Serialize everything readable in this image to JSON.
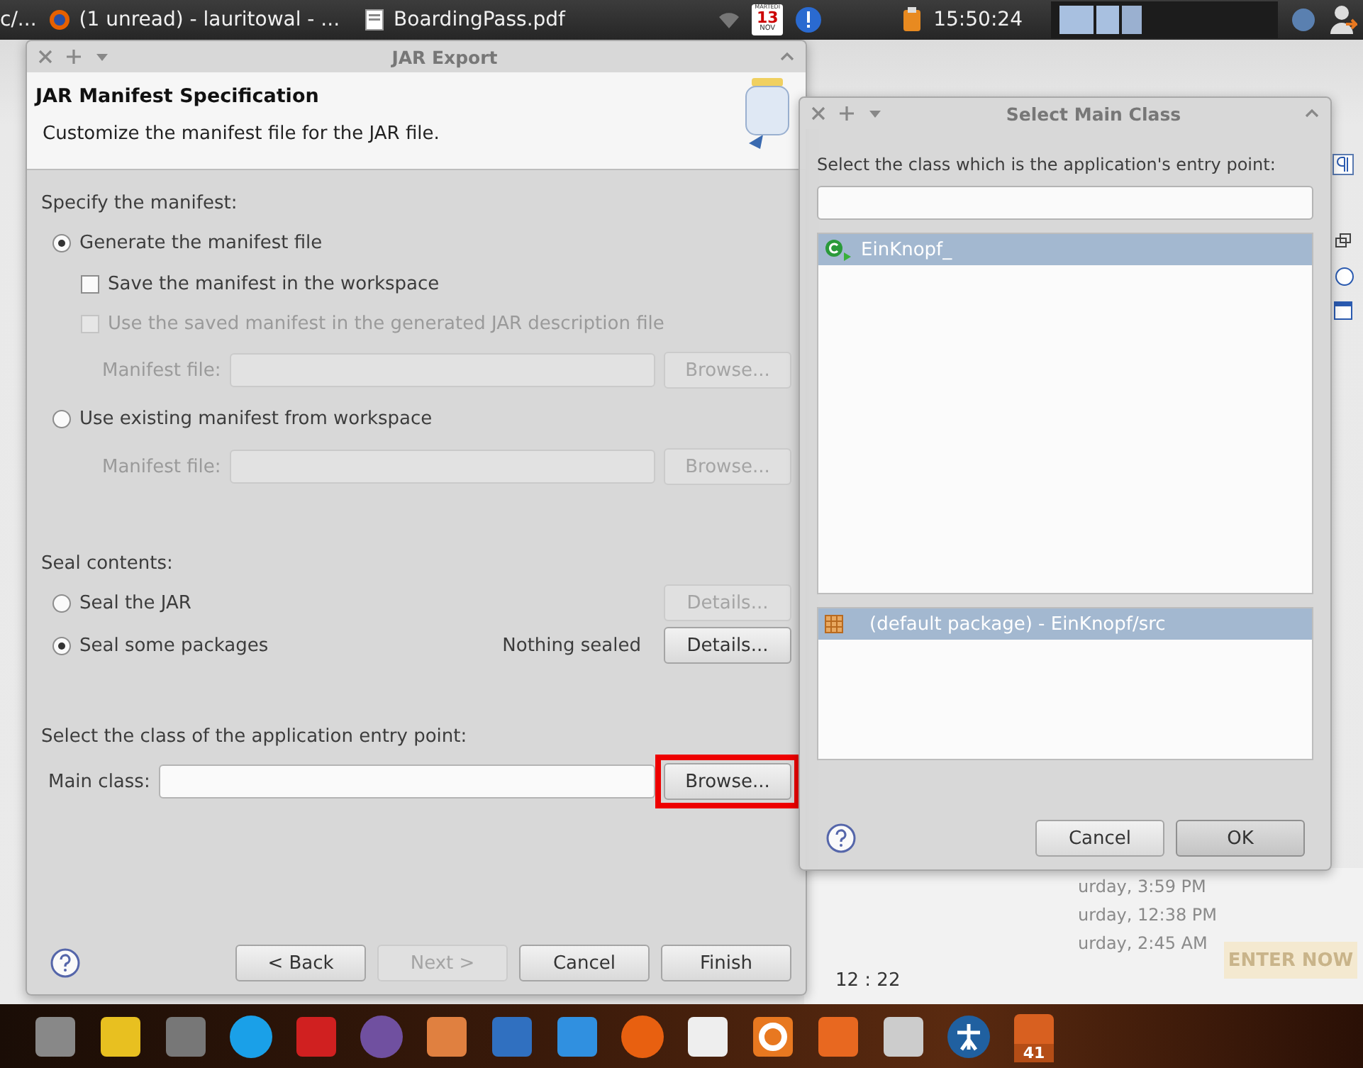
{
  "top_bar": {
    "cut_label": "c/...",
    "tasks": [
      {
        "kind": "browser",
        "label": "(1 unread) - lauritowal - ..."
      },
      {
        "kind": "pdf",
        "label": "BoardingPass.pdf"
      }
    ],
    "calendar": {
      "weekday": "MARTEDI",
      "day": "13",
      "month": "NOV"
    },
    "clock": "15:50:24"
  },
  "jar_export": {
    "title": "JAR Export",
    "heading": "JAR Manifest Specification",
    "description": "Customize the manifest file for the JAR file.",
    "sections": [
      {
        "heading": "Specify the manifest:",
        "items": [
          {
            "kind": "radio",
            "label": "Generate the manifest file",
            "selected": true,
            "children": [
              {
                "kind": "checkbox",
                "label": "Save the manifest in the workspace",
                "checked": false,
                "disabled": false
              },
              {
                "kind": "checkbox",
                "label": "Use the saved manifest in the generated JAR description file",
                "checked": false,
                "disabled": true
              },
              {
                "kind": "field",
                "label": "Manifest file:",
                "disabled": true,
                "button": {
                  "label": "Browse...",
                  "disabled": true,
                  "highlighted": false
                }
              }
            ]
          },
          {
            "kind": "radio",
            "label": "Use existing manifest from workspace",
            "selected": false,
            "children": [
              {
                "kind": "field",
                "label": "Manifest file:",
                "disabled": true,
                "button": {
                  "label": "Browse...",
                  "disabled": true,
                  "highlighted": false
                }
              }
            ]
          }
        ]
      },
      {
        "heading": "Seal contents:",
        "items": [
          {
            "kind": "radio",
            "label": "Seal the JAR",
            "selected": false,
            "button": {
              "label": "Details...",
              "disabled": true,
              "highlighted": false
            }
          },
          {
            "kind": "radio",
            "label": "Seal some packages",
            "selected": true,
            "note": "Nothing sealed",
            "button": {
              "label": "Details...",
              "disabled": false,
              "highlighted": false
            }
          }
        ]
      },
      {
        "heading": "Select the class of the application entry point:",
        "items": [
          {
            "kind": "field",
            "label": "Main class:",
            "disabled": false,
            "button": {
              "label": "Browse...",
              "disabled": false,
              "highlighted": true
            }
          }
        ]
      }
    ],
    "buttons": [
      {
        "label": "< Back",
        "disabled": false
      },
      {
        "label": "Next >",
        "disabled": true
      },
      {
        "label": "Cancel",
        "disabled": false
      },
      {
        "label": "Finish",
        "disabled": false
      }
    ]
  },
  "select_main_class": {
    "title": "Select Main Class",
    "prompt": "Select the class which is the application's entry point:",
    "types": [
      {
        "label": "EinKnopf_",
        "selected": true
      }
    ],
    "packages": [
      {
        "label": "(default package) - EinKnopf/src",
        "selected": true
      }
    ],
    "buttons": [
      {
        "label": "Cancel",
        "default": false
      },
      {
        "label": "OK",
        "default": true
      }
    ]
  },
  "background": {
    "dates": [
      "urday, 3:59 PM",
      "urday, 12:38 PM",
      "urday, 2:45 AM"
    ],
    "promo_button": "ENTER NOW",
    "status_time": "12 : 22"
  },
  "taskbar": {
    "trash_badge": "41"
  }
}
